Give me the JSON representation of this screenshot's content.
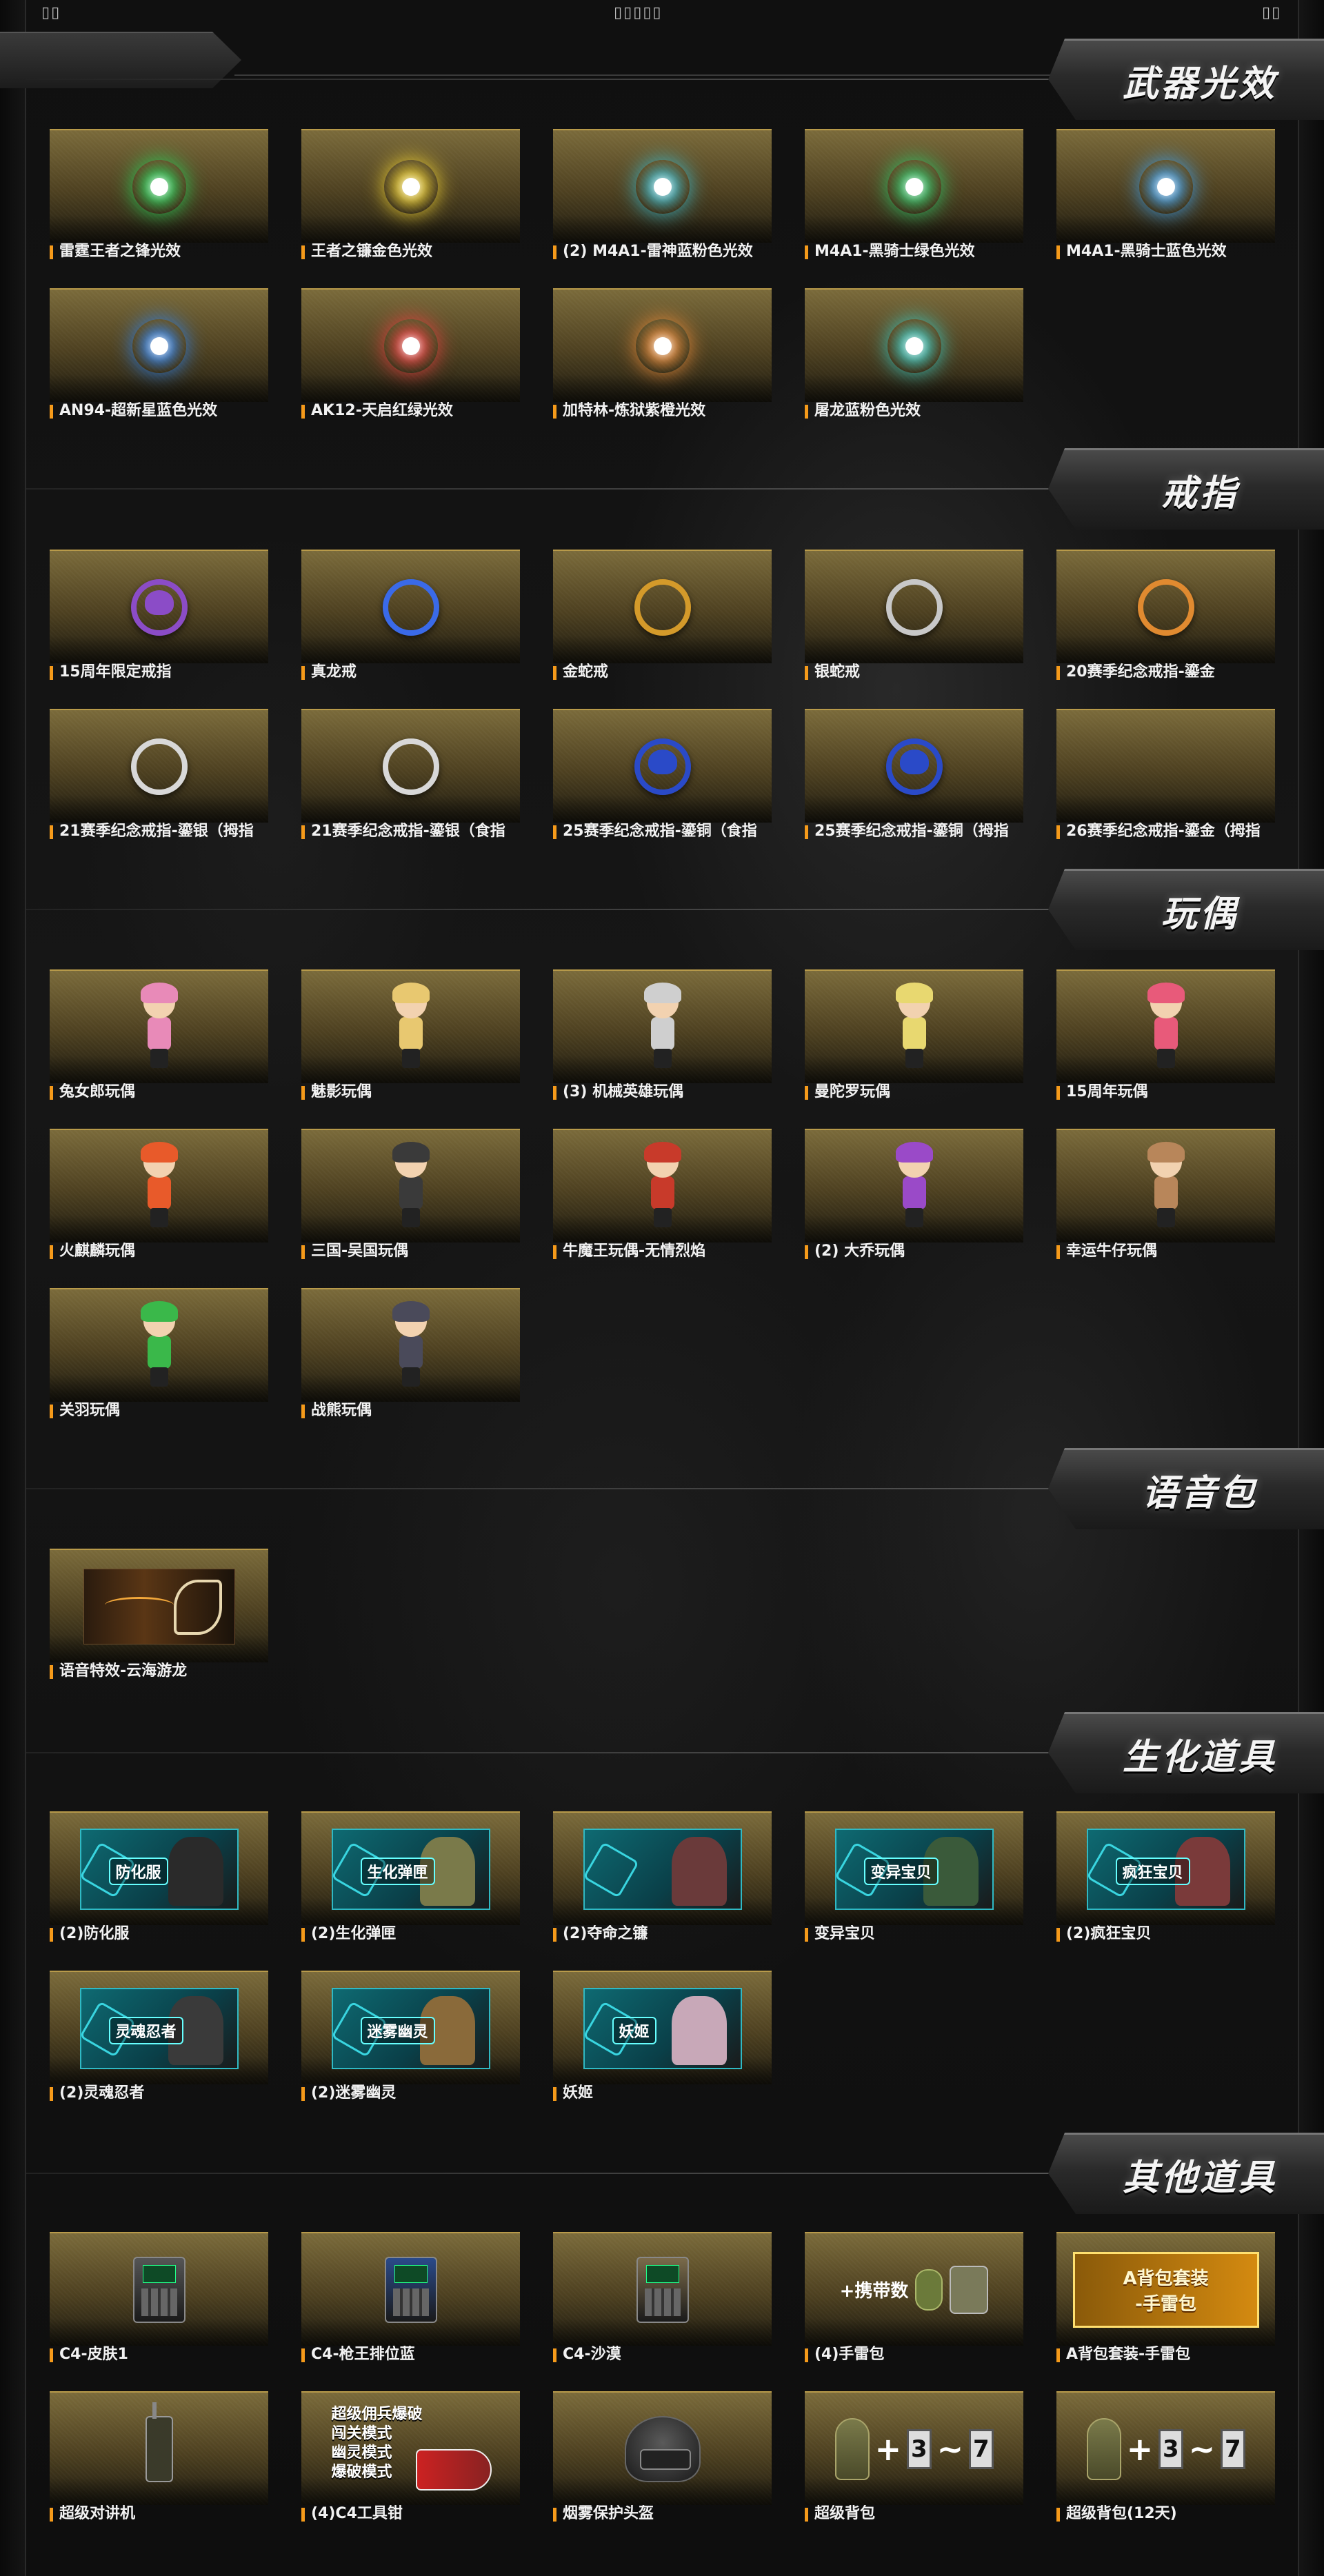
{
  "top": {
    "left_mark": "▯▯",
    "center_mark": "▯▯▯▯▯",
    "right_mark": "▯▯"
  },
  "sections": [
    {
      "title": "武器光效",
      "items": [
        {
          "label": "雷霆王者之锋光效",
          "icon": "glow-orb-icon",
          "color": "#29d05a"
        },
        {
          "label": "王者之镰金色光效",
          "icon": "glow-orb-icon",
          "color": "#f0d233"
        },
        {
          "label": "(2) M4A1-雷神蓝粉色光效",
          "icon": "glow-orb-icon",
          "color": "#3bb7c8"
        },
        {
          "label": "M4A1-黑骑士绿色光效",
          "icon": "glow-orb-icon",
          "color": "#2fc86a"
        },
        {
          "label": "M4A1-黑骑士蓝色光效",
          "icon": "glow-orb-icon",
          "color": "#3f9ee8"
        },
        {
          "label": "AN94-超新星蓝色光效",
          "icon": "glow-orb-icon",
          "color": "#2f80e8"
        },
        {
          "label": "AK12-天启红绿光效",
          "icon": "glow-orb-icon",
          "color": "#e84040"
        },
        {
          "label": "加特林-炼狱紫橙光效",
          "icon": "glow-orb-icon",
          "color": "#e88a3a"
        },
        {
          "label": "屠龙蓝粉色光效",
          "icon": "glow-orb-icon",
          "color": "#3ac8c0"
        }
      ]
    },
    {
      "title": "戒指",
      "items": [
        {
          "label": "15周年限定戒指",
          "icon": "star-ring-icon",
          "color": "#8b4cc7"
        },
        {
          "label": "真龙戒",
          "icon": "dragon-ring-icon",
          "color": "#3a6ae8"
        },
        {
          "label": "金蛇戒",
          "icon": "snake-ring-icon",
          "color": "#d49a2a"
        },
        {
          "label": "银蛇戒",
          "icon": "snake-ring-icon",
          "color": "#c8c8c8"
        },
        {
          "label": "20赛季纪念戒指-鎏金",
          "icon": "dragon-ring-icon",
          "color": "#e08a30"
        },
        {
          "label": "21赛季纪念戒指-鎏银（拇指",
          "icon": "tiger-ring-icon",
          "color": "#d8d8d8"
        },
        {
          "label": "21赛季纪念戒指-鎏银（食指",
          "icon": "tiger-ring-icon",
          "color": "#d8d8d8"
        },
        {
          "label": "25赛季纪念戒指-鎏铜（食指",
          "icon": "gem-ring-icon",
          "color": "#2a4ac8"
        },
        {
          "label": "25赛季纪念戒指-鎏铜（拇指",
          "icon": "gem-ring-icon",
          "color": "#2a4ac8"
        },
        {
          "label": "26赛季纪念戒指-鎏金（拇指",
          "icon": "empty-thumb",
          "color": ""
        }
      ]
    },
    {
      "title": "玩偶",
      "items": [
        {
          "label": "兔女郎玩偶",
          "icon": "doll-icon",
          "color": "#e88ab8"
        },
        {
          "label": "魅影玩偶",
          "icon": "doll-icon",
          "color": "#e8c870"
        },
        {
          "label": "(3) 机械英雄玩偶",
          "icon": "doll-icon",
          "color": "#cfcfcf"
        },
        {
          "label": "曼陀罗玩偶",
          "icon": "doll-icon",
          "color": "#e8d870"
        },
        {
          "label": "15周年玩偶",
          "icon": "doll-icon",
          "color": "#e85a7a"
        },
        {
          "label": "火麒麟玩偶",
          "icon": "doll-icon",
          "color": "#e85a2a"
        },
        {
          "label": "三国-吴国玩偶",
          "icon": "doll-icon",
          "color": "#3a3a3a"
        },
        {
          "label": "牛魔王玩偶-无情烈焰",
          "icon": "doll-icon",
          "color": "#c83a2a"
        },
        {
          "label": "(2) 大乔玩偶",
          "icon": "doll-icon",
          "color": "#9a4ac8"
        },
        {
          "label": "幸运牛仔玩偶",
          "icon": "doll-icon",
          "color": "#b8865a"
        },
        {
          "label": "关羽玩偶",
          "icon": "doll-icon",
          "color": "#3ab84a"
        },
        {
          "label": "战熊玩偶",
          "icon": "doll-icon",
          "color": "#4a4a5a"
        }
      ]
    },
    {
      "title": "语音包",
      "items": [
        {
          "label": "语音特效-云海游龙",
          "icon": "voice-art",
          "color": "#f3a83b"
        }
      ]
    },
    {
      "title": "生化道具",
      "items": [
        {
          "label": "(2)防化服",
          "icon": "bio-art",
          "tag": "防化服",
          "color": "#2a2a2a"
        },
        {
          "label": "(2)生化弹匣",
          "icon": "bio-art",
          "tag": "生化弹匣",
          "color": "#7a7a4a"
        },
        {
          "label": "(2)夺命之镰",
          "icon": "bio-art",
          "tag": "",
          "color": "#6a3a3a"
        },
        {
          "label": "变异宝贝",
          "icon": "bio-art",
          "tag": "变异宝贝",
          "color": "#3a5a3a"
        },
        {
          "label": "(2)疯狂宝贝",
          "icon": "bio-art",
          "tag": "疯狂宝贝",
          "color": "#7a3a3a"
        },
        {
          "label": "(2)灵魂忍者",
          "icon": "bio-art",
          "tag": "灵魂忍者",
          "color": "#3a3a3a"
        },
        {
          "label": "(2)迷雾幽灵",
          "icon": "bio-art",
          "tag": "迷雾幽灵",
          "color": "#8a6a3a"
        },
        {
          "label": "妖姬",
          "icon": "bio-art",
          "tag": "妖姬",
          "color": "#c8a8b8"
        }
      ]
    },
    {
      "title": "其他道具",
      "items": [
        {
          "label": "C4-皮肤1",
          "icon": "c4-device-icon",
          "color": "#555"
        },
        {
          "label": "C4-枪王排位蓝",
          "icon": "c4-device-icon",
          "color": "#2a4a8a"
        },
        {
          "label": "C4-沙漠",
          "icon": "c4-device-icon",
          "color": "#7a6a4a"
        },
        {
          "label": "(4)手雷包",
          "icon": "grenade-pouch-icon",
          "text": "+携带数",
          "color": "#6b7a3a"
        },
        {
          "label": "A背包套装-手雷包",
          "icon": "backpack-banner",
          "text_a": "A背包套装",
          "text_b": "-手雷包",
          "color": "#d48a10"
        },
        {
          "label": "超级对讲机",
          "icon": "radio-icon",
          "color": "#3a3a2a"
        },
        {
          "label": "(4)C4工具钳",
          "icon": "tool-text",
          "lines": [
            "超级佣兵爆破",
            "闯关模式",
            "幽灵模式",
            "爆破模式"
          ],
          "color": "#c22"
        },
        {
          "label": "烟雾保护头盔",
          "icon": "helmet-icon",
          "color": "#444"
        },
        {
          "label": "超级背包",
          "icon": "backpack-slots-icon",
          "a": "3",
          "b": "7",
          "color": "#7a7a4a"
        },
        {
          "label": "超级背包(12天)",
          "icon": "backpack-slots-icon",
          "a": "3",
          "b": "7",
          "color": "#7a7a4a"
        }
      ]
    }
  ]
}
